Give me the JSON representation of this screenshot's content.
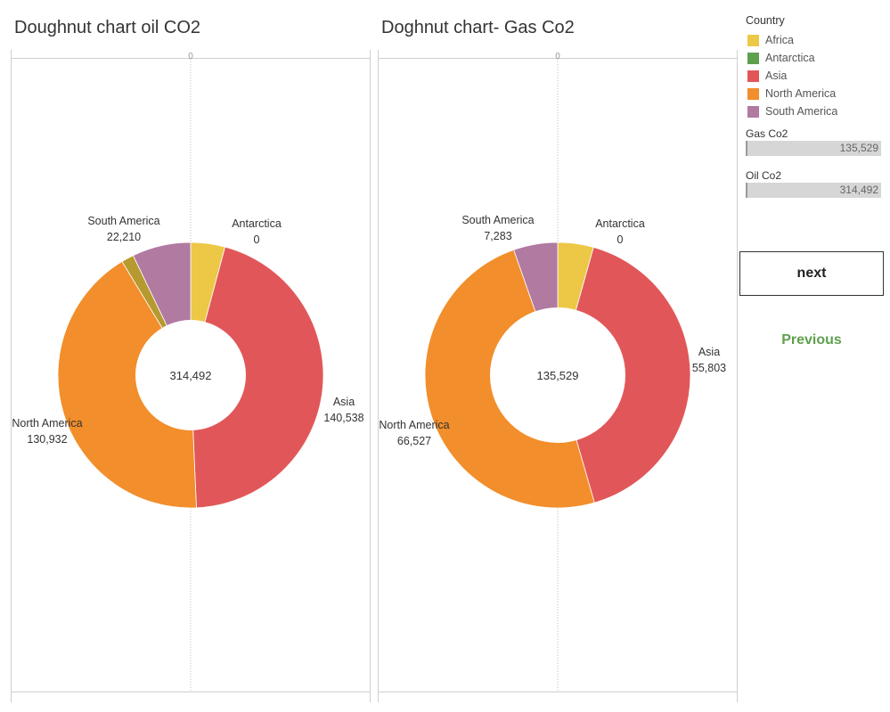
{
  "legend": {
    "title": "Country",
    "items": [
      {
        "label": "Africa",
        "color": "#ecc846"
      },
      {
        "label": "Antarctica",
        "color": "#5fa04e"
      },
      {
        "label": "Asia",
        "color": "#e15759"
      },
      {
        "label": "North America",
        "color": "#f28e2b"
      },
      {
        "label": "South America",
        "color": "#b07aa1"
      }
    ]
  },
  "measures": [
    {
      "label": "Gas Co2",
      "value": "135,529"
    },
    {
      "label": "Oil Co2",
      "value": "314,492"
    }
  ],
  "buttons": {
    "next": "next",
    "previous": "Previous"
  },
  "axis_zero_label": "0",
  "chart_data": [
    {
      "type": "pie",
      "title": "Doughnut chart oil CO2",
      "total_label": "314,492",
      "slices": [
        {
          "category": "Africa",
          "value": 13000,
          "color": "#ecc846",
          "label": "",
          "value_label": ""
        },
        {
          "category": "Asia",
          "value": 140538,
          "color": "#e15759",
          "label": "Asia",
          "value_label": "140,538"
        },
        {
          "category": "North America",
          "value": 130932,
          "color": "#f28e2b",
          "label": "North America",
          "value_label": "130,932"
        },
        {
          "category": "Other",
          "value": 4700,
          "color": "#b69a2f",
          "label": "",
          "value_label": ""
        },
        {
          "category": "South America",
          "value": 22210,
          "color": "#b07aa1",
          "label": "South America",
          "value_label": "22,210"
        },
        {
          "category": "Antarctica",
          "value": 0,
          "color": "#5fa04e",
          "label": "Antarctica",
          "value_label": "0"
        }
      ]
    },
    {
      "type": "pie",
      "title": "Doghnut chart- Gas Co2",
      "total_label": "135,529",
      "slices": [
        {
          "category": "Africa",
          "value": 5900,
          "color": "#ecc846",
          "label": "",
          "value_label": ""
        },
        {
          "category": "Asia",
          "value": 55803,
          "color": "#e15759",
          "label": "Asia",
          "value_label": "55,803"
        },
        {
          "category": "North America",
          "value": 66527,
          "color": "#f28e2b",
          "label": "North America",
          "value_label": "66,527"
        },
        {
          "category": "South America",
          "value": 7283,
          "color": "#b07aa1",
          "label": "South America",
          "value_label": "7,283"
        },
        {
          "category": "Antarctica",
          "value": 0,
          "color": "#5fa04e",
          "label": "Antarctica",
          "value_label": "0"
        }
      ]
    }
  ]
}
